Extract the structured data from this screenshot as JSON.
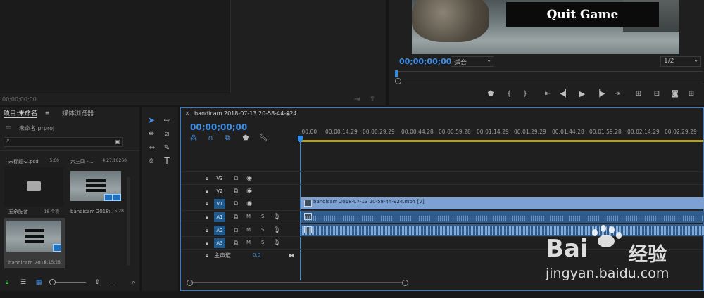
{
  "source_monitor": {
    "timecode": "00;00;00;00"
  },
  "program_monitor": {
    "timecode": "00;00;00;00",
    "fit": "适合",
    "resolution": "1/2",
    "preview_text": "Quit Game"
  },
  "project_panel": {
    "tab_project": "项目:未命名",
    "tab_media_browser": "媒体浏览器",
    "file_name": "未命名.prproj",
    "items": [
      {
        "name": "未标题-2.psd",
        "duration": "5:00"
      },
      {
        "name": "六三四 -...",
        "duration": "4:27:10260"
      },
      {
        "name": "五杀配音",
        "duration": "18 个项"
      },
      {
        "name": "bandicam 2018...",
        "duration": "5;15;28"
      },
      {
        "name": "bandicam 2018...",
        "duration": "5;15;28"
      }
    ]
  },
  "timeline": {
    "tab_title": "bandicam 2018-07-13 20-58-44-924",
    "timecode": "00;00;00;00",
    "ruler": [
      ":00;00",
      "00;00;14;29",
      "00;00;29;29",
      "00;00;44;28",
      "00;00;59;28",
      "00;01;14;29",
      "00;01;29;29",
      "00;01;44;28",
      "00;01;59;28",
      "00;02;14;29",
      "00;02;29;29"
    ],
    "video_tracks": [
      "V3",
      "V2",
      "V1"
    ],
    "audio_tracks": [
      "A1",
      "A2",
      "A3"
    ],
    "master_label": "主声道",
    "master_value": "0.0",
    "clip_label": "bandicam 2018-07-13 20-58-44-924.mp4 [V]",
    "mute": "M",
    "solo": "S"
  },
  "watermark": {
    "brand": "Bai",
    "brand2": "经验",
    "url": "jingyan.baidu.com"
  },
  "colors": {
    "accent": "#2d8ceb",
    "clip": "#7ca1d2",
    "audio": "#2f5c8c"
  }
}
